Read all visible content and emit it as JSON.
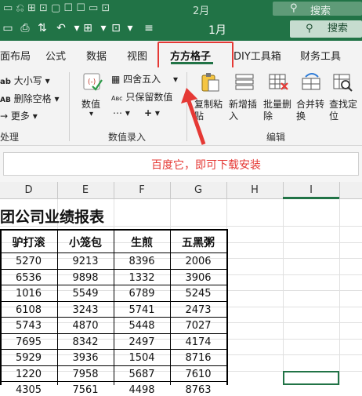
{
  "ghost_bar": {
    "label_month": "2月",
    "label_search": "搜索"
  },
  "titlebar": {
    "month": "1月",
    "search_label": "搜索"
  },
  "tabs": [
    {
      "label": "面布局"
    },
    {
      "label": "公式"
    },
    {
      "label": "数据"
    },
    {
      "label": "视图"
    },
    {
      "label": "方方格子"
    },
    {
      "label": "DIY工具箱"
    },
    {
      "label": "财务工具"
    }
  ],
  "ribbon": {
    "left": {
      "case_label": "大小写",
      "remove_space_label": "删除空格",
      "more_label": "更多",
      "group_label": "处理"
    },
    "numeric": {
      "value_label": "数值",
      "round_label": "四舍五入",
      "keep_value_label": "只保留数值",
      "plus_label": "+",
      "group_label": "数值录入"
    },
    "edit": {
      "copy_paste_label": "复制粘\n贴",
      "insert_label": "新增插\n入",
      "batch_delete_label": "批量删\n除",
      "merge_label": "合并转\n换",
      "find_label": "查找定\n位",
      "group_label": "编辑"
    }
  },
  "annotation": {
    "text": "百度它，即可下载安装"
  },
  "columns": [
    "D",
    "E",
    "F",
    "G",
    "H",
    "I"
  ],
  "sheet": {
    "title": "团公司业绩报表",
    "headers": [
      "驴打滚",
      "小笼包",
      "生煎",
      "五黑粥"
    ],
    "rows": [
      [
        "5270",
        "9213",
        "8396",
        "2006"
      ],
      [
        "6536",
        "9898",
        "1332",
        "3906"
      ],
      [
        "1016",
        "5549",
        "6789",
        "5245"
      ],
      [
        "6108",
        "3243",
        "5741",
        "2473"
      ],
      [
        "5743",
        "4870",
        "5448",
        "7027"
      ],
      [
        "7695",
        "8342",
        "2497",
        "4174"
      ],
      [
        "5929",
        "3936",
        "1504",
        "8716"
      ],
      [
        "1220",
        "7958",
        "5687",
        "7610"
      ],
      [
        "4305",
        "7561",
        "4498",
        "8763"
      ]
    ]
  },
  "colors": {
    "accent": "#217346",
    "annotation": "#e53935"
  }
}
